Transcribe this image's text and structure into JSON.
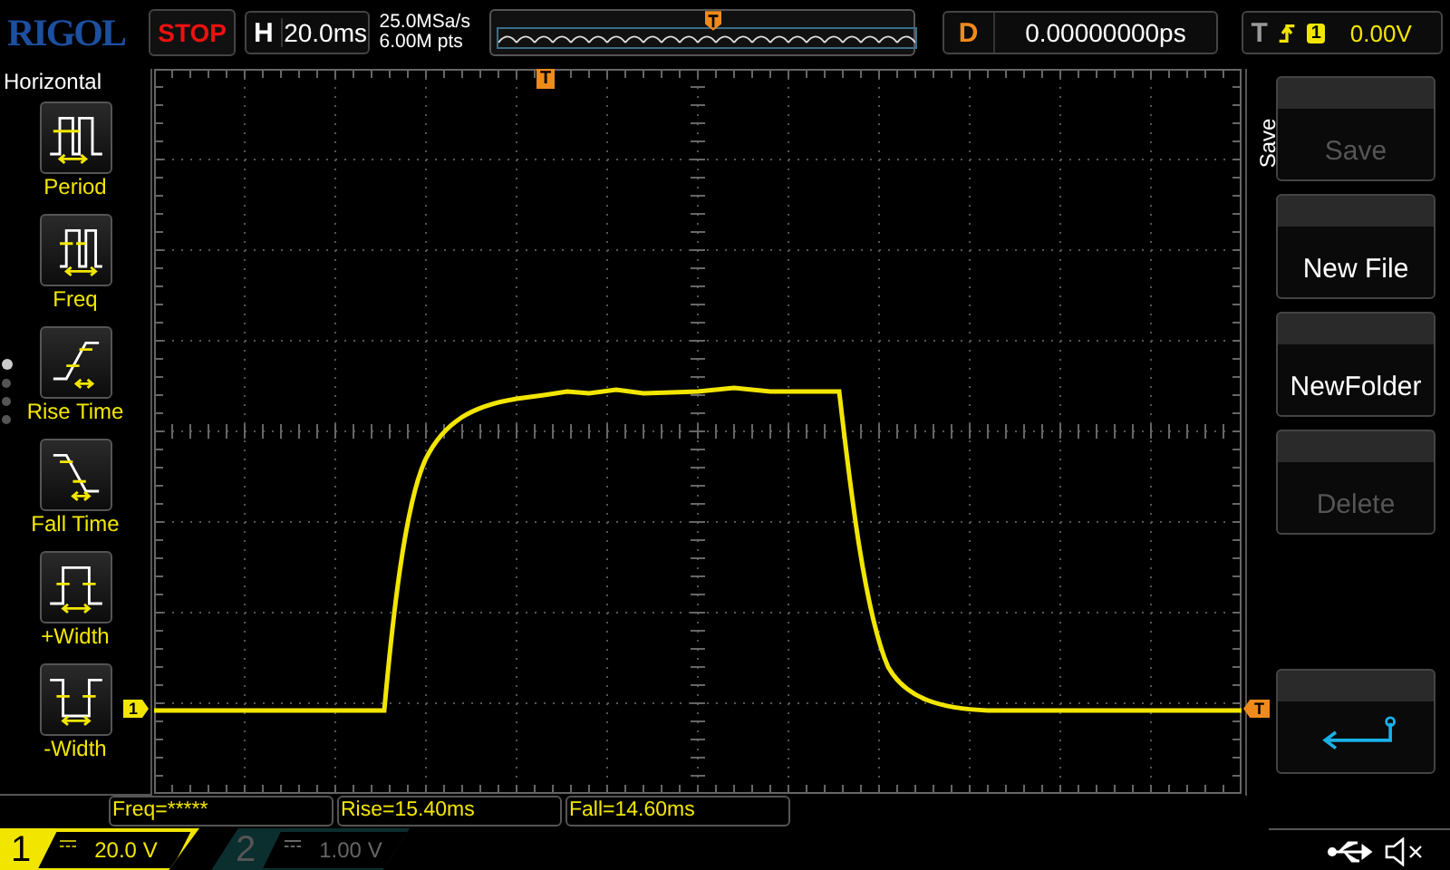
{
  "top_bar": {
    "logo": "RIGOL",
    "run_state": "STOP",
    "horizontal": {
      "label": "H",
      "value": "20.0ms"
    },
    "sample_rate": "25.0MSa/s",
    "memory_depth": "6.00M pts",
    "delay": {
      "label": "D",
      "value": "0.00000000ps"
    },
    "trigger": {
      "label": "T",
      "channel": "1",
      "level": "0.00V"
    }
  },
  "measure_menu": {
    "title": "Horizontal",
    "items": [
      {
        "label": "Period",
        "kind": "period"
      },
      {
        "label": "Freq",
        "kind": "freq"
      },
      {
        "label": "Rise Time",
        "kind": "rise"
      },
      {
        "label": "Fall Time",
        "kind": "fall"
      },
      {
        "label": "+Width",
        "kind": "pwidth"
      },
      {
        "label": "-Width",
        "kind": "nwidth"
      }
    ],
    "pages": [
      {
        "selected": true
      },
      {
        "selected": false
      },
      {
        "selected": false
      },
      {
        "selected": false
      }
    ]
  },
  "markers": {
    "trigger_position": "T",
    "channel_reference": "1",
    "trigger_level": "T"
  },
  "softkey_menu": {
    "title": "Save",
    "keys": [
      {
        "kind": "text",
        "label": "Save",
        "disabled": true
      },
      {
        "kind": "text",
        "label": "New File",
        "disabled": false
      },
      {
        "kind": "text",
        "label": "NewFolder",
        "disabled": false
      },
      {
        "kind": "text",
        "label": "Delete",
        "disabled": true
      },
      {
        "kind": "return"
      }
    ]
  },
  "measurements": [
    "Freq=*****",
    "Rise=15.40ms",
    "Fall=14.60ms"
  ],
  "channels": [
    {
      "number": "1",
      "scale": "20.0 V",
      "on": true
    },
    {
      "number": "2",
      "scale": "1.00 V",
      "on": false
    }
  ]
}
